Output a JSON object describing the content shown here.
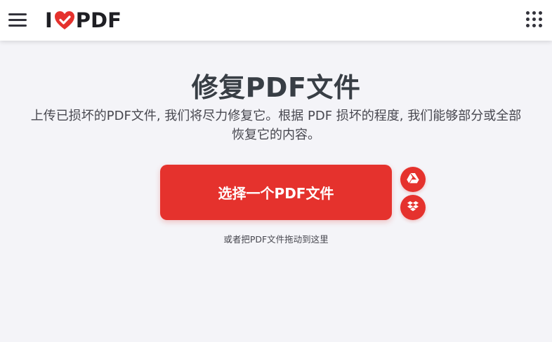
{
  "header": {
    "logo_letter": "I",
    "logo_word": "PDF",
    "menu_icon": "hamburger-icon",
    "apps_icon": "grid-apps-icon"
  },
  "main": {
    "title": "修复PDF文件",
    "subtitle": "上传已损坏的PDF文件, 我们将尽力修复它。根据 PDF 损坏的程度, 我们能够部分或全部恢复它的内容。",
    "select_button": "选择一个PDF文件",
    "drop_hint": "或者把PDF文件拖动到这里",
    "cloud_buttons": [
      "google-drive-icon",
      "dropbox-icon"
    ]
  },
  "colors": {
    "brand_red": "#e5322d",
    "background": "#f4f4f8",
    "text": "#33333b"
  }
}
